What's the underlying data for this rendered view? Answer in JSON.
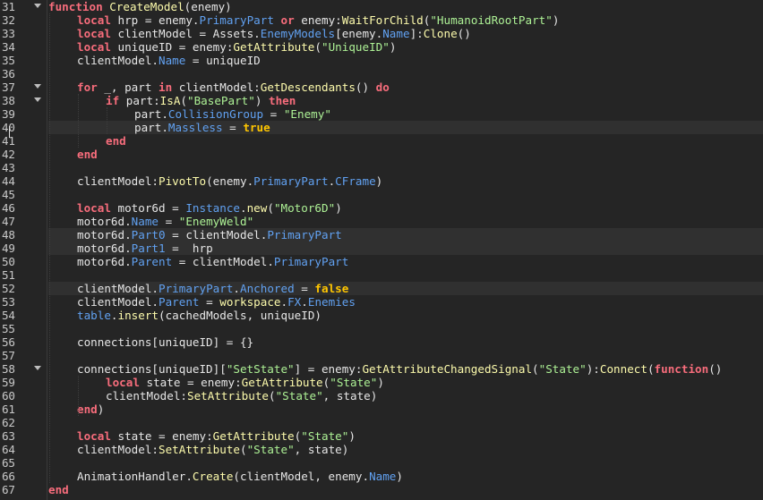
{
  "editor": {
    "language": "luau",
    "current_line": 40,
    "colors": {
      "background": "#252525",
      "keyword": "#f86d7c",
      "function_call": "#fdfbac",
      "property": "#61a1f1",
      "string": "#adf195",
      "boolean": "#ffc600",
      "text": "#e6e6e6",
      "highlighted_line": "#303030"
    },
    "lines": [
      {
        "num": "31",
        "fold": true,
        "hl": false,
        "indent": 0,
        "tokens": [
          {
            "t": "function",
            "c": "kw"
          },
          {
            "t": " ",
            "c": "tx"
          },
          {
            "t": "CreateModel",
            "c": "fn"
          },
          {
            "t": "(enemy)",
            "c": "tx"
          }
        ]
      },
      {
        "num": "32",
        "fold": false,
        "hl": false,
        "indent": 1,
        "tokens": [
          {
            "t": "local",
            "c": "kw"
          },
          {
            "t": " hrp = enemy.",
            "c": "tx"
          },
          {
            "t": "PrimaryPart",
            "c": "prop"
          },
          {
            "t": " ",
            "c": "tx"
          },
          {
            "t": "or",
            "c": "kw"
          },
          {
            "t": " enemy:",
            "c": "tx"
          },
          {
            "t": "WaitForChild",
            "c": "fn"
          },
          {
            "t": "(",
            "c": "tx"
          },
          {
            "t": "\"HumanoidRootPart\"",
            "c": "str"
          },
          {
            "t": ")",
            "c": "tx"
          }
        ]
      },
      {
        "num": "33",
        "fold": false,
        "hl": false,
        "indent": 1,
        "tokens": [
          {
            "t": "local",
            "c": "kw"
          },
          {
            "t": " clientModel = Assets.",
            "c": "tx"
          },
          {
            "t": "EnemyModels",
            "c": "prop"
          },
          {
            "t": "[enemy.",
            "c": "tx"
          },
          {
            "t": "Name",
            "c": "prop"
          },
          {
            "t": "]:",
            "c": "tx"
          },
          {
            "t": "Clone",
            "c": "fn"
          },
          {
            "t": "()",
            "c": "tx"
          }
        ]
      },
      {
        "num": "34",
        "fold": false,
        "hl": false,
        "indent": 1,
        "tokens": [
          {
            "t": "local",
            "c": "kw"
          },
          {
            "t": " uniqueID = enemy:",
            "c": "tx"
          },
          {
            "t": "GetAttribute",
            "c": "fn"
          },
          {
            "t": "(",
            "c": "tx"
          },
          {
            "t": "\"UniqueID\"",
            "c": "str"
          },
          {
            "t": ")",
            "c": "tx"
          }
        ]
      },
      {
        "num": "35",
        "fold": false,
        "hl": false,
        "indent": 1,
        "tokens": [
          {
            "t": "clientModel.",
            "c": "tx"
          },
          {
            "t": "Name",
            "c": "prop"
          },
          {
            "t": " = uniqueID",
            "c": "tx"
          }
        ]
      },
      {
        "num": "36",
        "fold": false,
        "hl": false,
        "indent": 1,
        "tokens": []
      },
      {
        "num": "37",
        "fold": true,
        "hl": false,
        "indent": 1,
        "tokens": [
          {
            "t": "for",
            "c": "kw"
          },
          {
            "t": " _, part ",
            "c": "tx"
          },
          {
            "t": "in",
            "c": "kw"
          },
          {
            "t": " clientModel:",
            "c": "tx"
          },
          {
            "t": "GetDescendants",
            "c": "fn"
          },
          {
            "t": "() ",
            "c": "tx"
          },
          {
            "t": "do",
            "c": "kw"
          }
        ]
      },
      {
        "num": "38",
        "fold": true,
        "hl": false,
        "indent": 2,
        "tokens": [
          {
            "t": "if",
            "c": "kw"
          },
          {
            "t": " part:",
            "c": "tx"
          },
          {
            "t": "IsA",
            "c": "fn"
          },
          {
            "t": "(",
            "c": "tx"
          },
          {
            "t": "\"BasePart\"",
            "c": "str"
          },
          {
            "t": ") ",
            "c": "tx"
          },
          {
            "t": "then",
            "c": "kw"
          }
        ]
      },
      {
        "num": "39",
        "fold": false,
        "hl": false,
        "indent": 3,
        "tokens": [
          {
            "t": "part.",
            "c": "tx"
          },
          {
            "t": "CollisionGroup",
            "c": "prop"
          },
          {
            "t": " = ",
            "c": "tx"
          },
          {
            "t": "\"Enemy\"",
            "c": "str"
          }
        ]
      },
      {
        "num": "40",
        "fold": false,
        "hl": true,
        "indent": 3,
        "tokens": [
          {
            "t": "part.",
            "c": "tx"
          },
          {
            "t": "Massless",
            "c": "prop"
          },
          {
            "t": " = ",
            "c": "tx"
          },
          {
            "t": "true",
            "c": "bool"
          }
        ]
      },
      {
        "num": "41",
        "fold": false,
        "hl": false,
        "indent": 2,
        "tokens": [
          {
            "t": "end",
            "c": "kw"
          }
        ]
      },
      {
        "num": "42",
        "fold": false,
        "hl": false,
        "indent": 1,
        "tokens": [
          {
            "t": "end",
            "c": "kw"
          }
        ]
      },
      {
        "num": "43",
        "fold": false,
        "hl": false,
        "indent": 1,
        "tokens": []
      },
      {
        "num": "44",
        "fold": false,
        "hl": false,
        "indent": 1,
        "tokens": [
          {
            "t": "clientModel:",
            "c": "tx"
          },
          {
            "t": "PivotTo",
            "c": "fn"
          },
          {
            "t": "(enemy.",
            "c": "tx"
          },
          {
            "t": "PrimaryPart",
            "c": "prop"
          },
          {
            "t": ".",
            "c": "tx"
          },
          {
            "t": "CFrame",
            "c": "prop"
          },
          {
            "t": ")",
            "c": "tx"
          }
        ]
      },
      {
        "num": "45",
        "fold": false,
        "hl": false,
        "indent": 1,
        "tokens": []
      },
      {
        "num": "46",
        "fold": false,
        "hl": false,
        "indent": 1,
        "tokens": [
          {
            "t": "local",
            "c": "kw"
          },
          {
            "t": " motor6d = ",
            "c": "tx"
          },
          {
            "t": "Instance",
            "c": "prop"
          },
          {
            "t": ".",
            "c": "tx"
          },
          {
            "t": "new",
            "c": "fn"
          },
          {
            "t": "(",
            "c": "tx"
          },
          {
            "t": "\"Motor6D\"",
            "c": "str"
          },
          {
            "t": ")",
            "c": "tx"
          }
        ]
      },
      {
        "num": "47",
        "fold": false,
        "hl": false,
        "indent": 1,
        "tokens": [
          {
            "t": "motor6d.",
            "c": "tx"
          },
          {
            "t": "Name",
            "c": "prop"
          },
          {
            "t": " = ",
            "c": "tx"
          },
          {
            "t": "\"EnemyWeld\"",
            "c": "str"
          }
        ]
      },
      {
        "num": "48",
        "fold": false,
        "hl": true,
        "indent": 1,
        "tokens": [
          {
            "t": "motor6d.",
            "c": "tx"
          },
          {
            "t": "Part0",
            "c": "prop"
          },
          {
            "t": " = clientModel.",
            "c": "tx"
          },
          {
            "t": "PrimaryPart",
            "c": "prop"
          }
        ]
      },
      {
        "num": "49",
        "fold": false,
        "hl": true,
        "indent": 1,
        "tokens": [
          {
            "t": "motor6d.",
            "c": "tx"
          },
          {
            "t": "Part1",
            "c": "prop"
          },
          {
            "t": " =  hrp",
            "c": "tx"
          }
        ]
      },
      {
        "num": "50",
        "fold": false,
        "hl": false,
        "indent": 1,
        "tokens": [
          {
            "t": "motor6d.",
            "c": "tx"
          },
          {
            "t": "Parent",
            "c": "prop"
          },
          {
            "t": " = clientModel.",
            "c": "tx"
          },
          {
            "t": "PrimaryPart",
            "c": "prop"
          }
        ]
      },
      {
        "num": "51",
        "fold": false,
        "hl": false,
        "indent": 1,
        "tokens": []
      },
      {
        "num": "52",
        "fold": false,
        "hl": true,
        "indent": 1,
        "tokens": [
          {
            "t": "clientModel.",
            "c": "tx"
          },
          {
            "t": "PrimaryPart",
            "c": "prop"
          },
          {
            "t": ".",
            "c": "tx"
          },
          {
            "t": "Anchored",
            "c": "prop"
          },
          {
            "t": " = ",
            "c": "tx"
          },
          {
            "t": "false",
            "c": "bool"
          }
        ]
      },
      {
        "num": "53",
        "fold": false,
        "hl": false,
        "indent": 1,
        "tokens": [
          {
            "t": "clientModel.",
            "c": "tx"
          },
          {
            "t": "Parent",
            "c": "prop"
          },
          {
            "t": " = ",
            "c": "tx"
          },
          {
            "t": "workspace",
            "c": "fn"
          },
          {
            "t": ".",
            "c": "tx"
          },
          {
            "t": "FX",
            "c": "prop"
          },
          {
            "t": ".",
            "c": "tx"
          },
          {
            "t": "Enemies",
            "c": "prop"
          }
        ]
      },
      {
        "num": "54",
        "fold": false,
        "hl": false,
        "indent": 1,
        "tokens": [
          {
            "t": "table",
            "c": "prop"
          },
          {
            "t": ".",
            "c": "tx"
          },
          {
            "t": "insert",
            "c": "fn"
          },
          {
            "t": "(cachedModels, uniqueID)",
            "c": "tx"
          }
        ]
      },
      {
        "num": "55",
        "fold": false,
        "hl": false,
        "indent": 1,
        "tokens": []
      },
      {
        "num": "56",
        "fold": false,
        "hl": false,
        "indent": 1,
        "tokens": [
          {
            "t": "connections[uniqueID] = {}",
            "c": "tx"
          }
        ]
      },
      {
        "num": "57",
        "fold": false,
        "hl": false,
        "indent": 1,
        "tokens": []
      },
      {
        "num": "58",
        "fold": true,
        "hl": false,
        "indent": 1,
        "tokens": [
          {
            "t": "connections[uniqueID][",
            "c": "tx"
          },
          {
            "t": "\"SetState\"",
            "c": "str"
          },
          {
            "t": "] = enemy:",
            "c": "tx"
          },
          {
            "t": "GetAttributeChangedSignal",
            "c": "fn"
          },
          {
            "t": "(",
            "c": "tx"
          },
          {
            "t": "\"State\"",
            "c": "str"
          },
          {
            "t": "):",
            "c": "tx"
          },
          {
            "t": "Connect",
            "c": "fn"
          },
          {
            "t": "(",
            "c": "tx"
          },
          {
            "t": "function",
            "c": "kw"
          },
          {
            "t": "()",
            "c": "tx"
          }
        ]
      },
      {
        "num": "59",
        "fold": false,
        "hl": false,
        "indent": 2,
        "tokens": [
          {
            "t": "local",
            "c": "kw"
          },
          {
            "t": " state = enemy:",
            "c": "tx"
          },
          {
            "t": "GetAttribute",
            "c": "fn"
          },
          {
            "t": "(",
            "c": "tx"
          },
          {
            "t": "\"State\"",
            "c": "str"
          },
          {
            "t": ")",
            "c": "tx"
          }
        ]
      },
      {
        "num": "60",
        "fold": false,
        "hl": false,
        "indent": 2,
        "tokens": [
          {
            "t": "clientModel:",
            "c": "tx"
          },
          {
            "t": "SetAttribute",
            "c": "fn"
          },
          {
            "t": "(",
            "c": "tx"
          },
          {
            "t": "\"State\"",
            "c": "str"
          },
          {
            "t": ", state)",
            "c": "tx"
          }
        ]
      },
      {
        "num": "61",
        "fold": false,
        "hl": false,
        "indent": 1,
        "tokens": [
          {
            "t": "end",
            "c": "kw"
          },
          {
            "t": ")",
            "c": "tx"
          }
        ]
      },
      {
        "num": "62",
        "fold": false,
        "hl": false,
        "indent": 1,
        "tokens": []
      },
      {
        "num": "63",
        "fold": false,
        "hl": false,
        "indent": 1,
        "tokens": [
          {
            "t": "local",
            "c": "kw"
          },
          {
            "t": " state = enemy:",
            "c": "tx"
          },
          {
            "t": "GetAttribute",
            "c": "fn"
          },
          {
            "t": "(",
            "c": "tx"
          },
          {
            "t": "\"State\"",
            "c": "str"
          },
          {
            "t": ")",
            "c": "tx"
          }
        ]
      },
      {
        "num": "64",
        "fold": false,
        "hl": false,
        "indent": 1,
        "tokens": [
          {
            "t": "clientModel:",
            "c": "tx"
          },
          {
            "t": "SetAttribute",
            "c": "fn"
          },
          {
            "t": "(",
            "c": "tx"
          },
          {
            "t": "\"State\"",
            "c": "str"
          },
          {
            "t": ", state)",
            "c": "tx"
          }
        ]
      },
      {
        "num": "65",
        "fold": false,
        "hl": false,
        "indent": 1,
        "tokens": []
      },
      {
        "num": "66",
        "fold": false,
        "hl": false,
        "indent": 1,
        "tokens": [
          {
            "t": "AnimationHandler.",
            "c": "tx"
          },
          {
            "t": "Create",
            "c": "fn"
          },
          {
            "t": "(clientModel, enemy.",
            "c": "tx"
          },
          {
            "t": "Name",
            "c": "prop"
          },
          {
            "t": ")",
            "c": "tx"
          }
        ]
      },
      {
        "num": "67",
        "fold": false,
        "hl": false,
        "indent": 0,
        "tokens": [
          {
            "t": "end",
            "c": "kw"
          }
        ]
      }
    ]
  }
}
